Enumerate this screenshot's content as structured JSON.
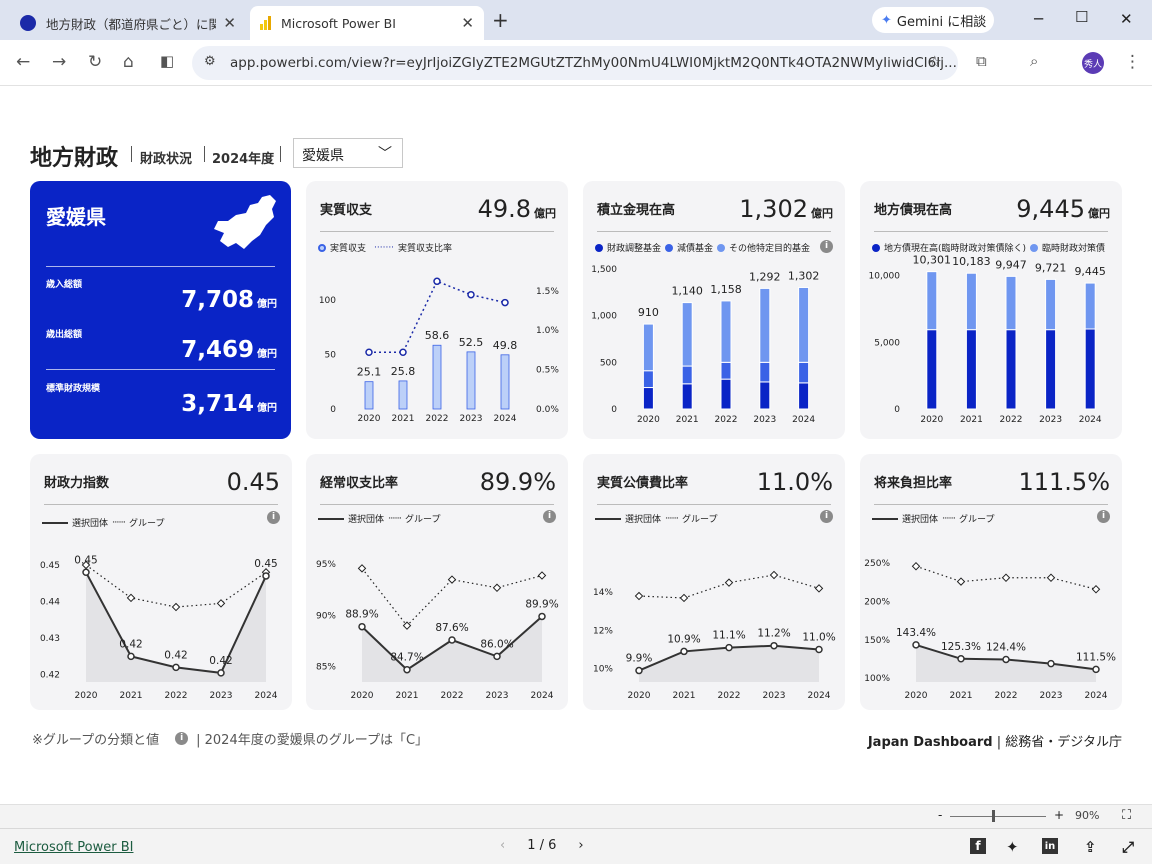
{
  "browser": {
    "tabs": [
      {
        "title": "地方財政（都道府県ごと）に関す"
      },
      {
        "title": "Microsoft Power BI"
      }
    ],
    "gemini_label": "Gemini に相談",
    "url": "app.powerbi.com/view?r=eyJrIjoiZGIyZTE2MGUtZTZhMy00NmU4LWI0MjktM2Q0NTk4OTA2NWMyIiwidCI6Ij...",
    "avatar_text": "秀人"
  },
  "header": {
    "title": "地方財政",
    "sub1": "財政状況",
    "sub2": "2024年度",
    "prefecture_select": "愛媛県"
  },
  "pref_card": {
    "name": "愛媛県",
    "metrics": [
      {
        "label": "歳入総額",
        "value": "7,708",
        "unit": "億円"
      },
      {
        "label": "歳出総額",
        "value": "7,469",
        "unit": "億円"
      },
      {
        "label": "標準財政規模",
        "value": "3,714",
        "unit": "億円"
      }
    ]
  },
  "cards": {
    "real_balance": {
      "title": "実質収支",
      "value": "49.8",
      "unit": "億円",
      "legend": [
        "実質収支",
        "実質収支比率"
      ]
    },
    "reserve_fund": {
      "title": "積立金現在高",
      "value": "1,302",
      "unit": "億円",
      "legend": [
        "財政調整基金",
        "減債基金",
        "その他特定目的基金"
      ]
    },
    "local_debt": {
      "title": "地方債現在高",
      "value": "9,445",
      "unit": "億円",
      "legend": [
        "地方債現在高(臨時財政対策債除く)",
        "臨時財政対策債"
      ]
    },
    "fiscal_power": {
      "title": "財政力指数",
      "value": "0.45",
      "legend": [
        "選択団体",
        "グループ"
      ]
    },
    "ordinary_ratio": {
      "title": "経常収支比率",
      "value": "89.9%",
      "legend": [
        "選択団体",
        "グループ"
      ]
    },
    "debt_service": {
      "title": "実質公債費比率",
      "value": "11.0%",
      "legend": [
        "選択団体",
        "グループ"
      ]
    },
    "future_burden": {
      "title": "将来負担比率",
      "value": "111.5%",
      "legend": [
        "選択団体",
        "グループ"
      ]
    }
  },
  "footer": {
    "note_left": "※グループの分類と値",
    "note_right": "| 2024年度の愛媛県のグループは「C」",
    "credit_brand": "Japan Dashboard",
    "credit_rest": "| 総務省・デジタル庁"
  },
  "zoom": {
    "minus": "-",
    "plus": "+",
    "level": "90%"
  },
  "pbi_bar": {
    "link": "Microsoft Power BI",
    "page": "1 / 6"
  },
  "colors": {
    "accent": "#0a24c6",
    "light_series": "#6f96f0",
    "mid_series": "#3a62e6",
    "dark_series": "#0a24c6"
  },
  "chart_data": [
    {
      "id": "real_balance",
      "type": "bar",
      "categories": [
        "2020",
        "2021",
        "2022",
        "2023",
        "2024"
      ],
      "series": [
        {
          "name": "実質収支",
          "values": [
            25.1,
            25.8,
            58.6,
            52.5,
            49.8
          ]
        },
        {
          "name": "実質収支比率",
          "values": [
            0.72,
            0.72,
            1.62,
            1.45,
            1.35
          ]
        }
      ],
      "ylim": [
        0,
        125
      ],
      "y_ticks": [
        "0",
        "50",
        "100"
      ],
      "y2lim": [
        0,
        1.7
      ],
      "y2_ticks": [
        "0.0%",
        "0.5%",
        "1.0%",
        "1.5%"
      ]
    },
    {
      "id": "reserve_fund",
      "type": "bar",
      "categories": [
        "2020",
        "2021",
        "2022",
        "2023",
        "2024"
      ],
      "series": [
        {
          "name": "財政調整基金",
          "values": [
            230,
            270,
            320,
            290,
            280
          ]
        },
        {
          "name": "減債基金",
          "values": [
            180,
            190,
            180,
            210,
            220
          ]
        },
        {
          "name": "その他特定目的基金",
          "values": [
            500,
            680,
            658,
            792,
            802
          ]
        }
      ],
      "totals": [
        "910",
        "1,140",
        "1,158",
        "1,292",
        "1,302"
      ],
      "ylim": [
        0,
        1500
      ],
      "y_ticks": [
        "0",
        "500",
        "1,000",
        "1,500"
      ]
    },
    {
      "id": "local_debt",
      "type": "bar",
      "categories": [
        "2020",
        "2021",
        "2022",
        "2023",
        "2024"
      ],
      "series": [
        {
          "name": "地方債現在高(臨時財政対策債除く)",
          "values": [
            5950,
            5950,
            5950,
            5950,
            6000
          ]
        },
        {
          "name": "臨時財政対策債",
          "values": [
            4351,
            4233,
            3997,
            3771,
            3445
          ]
        }
      ],
      "totals": [
        "10,301",
        "10,183",
        "9,947",
        "9,721",
        "9,445"
      ],
      "ylim": [
        0,
        10500
      ],
      "y_ticks": [
        "0",
        "5,000",
        "10,000"
      ]
    },
    {
      "id": "fiscal_power",
      "type": "line",
      "categories": [
        "2020",
        "2021",
        "2022",
        "2023",
        "2024"
      ],
      "series": [
        {
          "name": "選択団体",
          "values": [
            0.448,
            0.425,
            0.422,
            0.4205,
            0.447
          ]
        },
        {
          "name": "グループ",
          "values": [
            0.45,
            0.441,
            0.4385,
            0.4395,
            0.448
          ]
        }
      ],
      "labels": [
        "0.45",
        "0.42",
        "0.42",
        "0.42",
        "0.45"
      ],
      "ylim": [
        0.418,
        0.453
      ],
      "y_ticks": [
        {
          "v": 0.42,
          "t": "0.42"
        },
        {
          "v": 0.43,
          "t": "0.43"
        },
        {
          "v": 0.44,
          "t": "0.44"
        },
        {
          "v": 0.45,
          "t": "0.45"
        }
      ]
    },
    {
      "id": "ordinary_ratio",
      "type": "line",
      "categories": [
        "2020",
        "2021",
        "2022",
        "2023",
        "2024"
      ],
      "series": [
        {
          "name": "選択団体",
          "values": [
            88.9,
            84.7,
            87.6,
            86.0,
            89.9
          ]
        },
        {
          "name": "グループ",
          "values": [
            94.6,
            89.0,
            93.5,
            92.7,
            93.9
          ]
        }
      ],
      "labels": [
        "88.9%",
        "84.7%",
        "87.6%",
        "86.0%",
        "89.9%"
      ],
      "ylim": [
        83.5,
        96.0
      ],
      "y_ticks": [
        {
          "v": 85,
          "t": "85%"
        },
        {
          "v": 90,
          "t": "90%"
        },
        {
          "v": 95,
          "t": "95%"
        }
      ]
    },
    {
      "id": "debt_service",
      "type": "line",
      "categories": [
        "2020",
        "2021",
        "2022",
        "2023",
        "2024"
      ],
      "series": [
        {
          "name": "選択団体",
          "values": [
            9.9,
            10.9,
            11.1,
            11.2,
            11.0
          ]
        },
        {
          "name": "グループ",
          "values": [
            13.8,
            13.7,
            14.5,
            14.9,
            14.2
          ]
        }
      ],
      "labels": [
        "9.9%",
        "10.9%",
        "11.1%",
        "11.2%",
        "11.0%"
      ],
      "ylim": [
        9.3,
        16.0
      ],
      "y_ticks": [
        {
          "v": 10,
          "t": "10%"
        },
        {
          "v": 12,
          "t": "12%"
        },
        {
          "v": 14,
          "t": "14%"
        }
      ]
    },
    {
      "id": "future_burden",
      "type": "line",
      "categories": [
        "2020",
        "2021",
        "2022",
        "2023",
        "2024"
      ],
      "series": [
        {
          "name": "選択団体",
          "values": [
            143.4,
            125.3,
            124.4,
            119.0,
            111.5
          ]
        },
        {
          "name": "グループ",
          "values": [
            246,
            226,
            231,
            231,
            216
          ]
        }
      ],
      "labels": [
        "143.4%",
        "125.3%",
        "124.4%",
        "",
        "111.5%"
      ],
      "ylim": [
        95,
        262
      ],
      "y_ticks": [
        {
          "v": 100,
          "t": "100%"
        },
        {
          "v": 150,
          "t": "150%"
        },
        {
          "v": 200,
          "t": "200%"
        },
        {
          "v": 250,
          "t": "250%"
        }
      ]
    }
  ]
}
